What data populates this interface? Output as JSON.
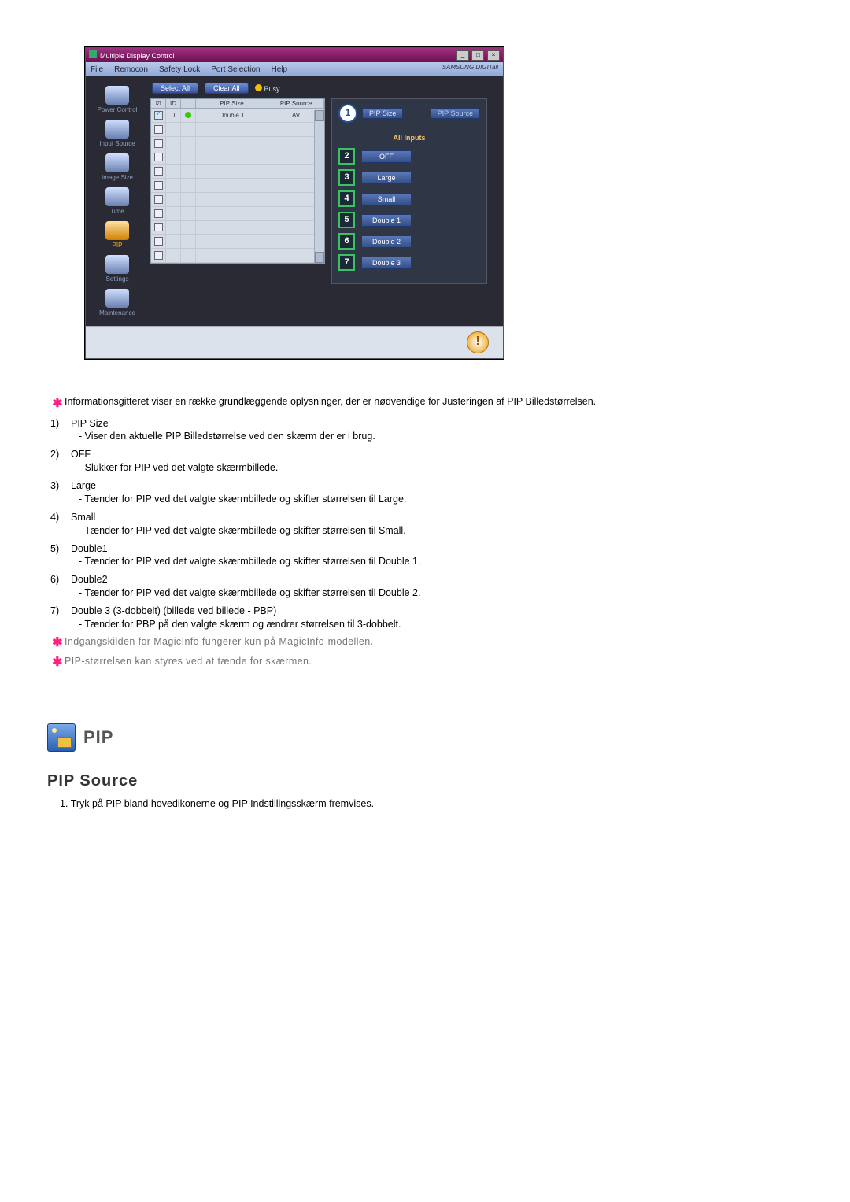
{
  "window": {
    "title": "Multiple Display Control",
    "menu": [
      "File",
      "Remocon",
      "Safety Lock",
      "Port Selection",
      "Help"
    ],
    "brand": "SAMSUNG DIGITall"
  },
  "sidebar": [
    {
      "label": "Power Control"
    },
    {
      "label": "Input Source"
    },
    {
      "label": "Image Size"
    },
    {
      "label": "Time"
    },
    {
      "label": "PIP",
      "active": true
    },
    {
      "label": "Settings"
    },
    {
      "label": "Maintenance"
    }
  ],
  "topbar": {
    "select_all": "Select All",
    "clear_all": "Clear All",
    "busy": "Busy"
  },
  "grid": {
    "headers": {
      "chk": "☑",
      "id": "ID",
      "st": "",
      "size": "PIP Size",
      "source": "PIP Source"
    },
    "first_row": {
      "id": "0",
      "size": "Double 1",
      "source": "AV"
    }
  },
  "panel": {
    "tab_size": "PIP Size",
    "tab_source": "PIP Source",
    "callout1": "1",
    "all_inputs": "All Inputs",
    "options": [
      {
        "n": "2",
        "label": "OFF"
      },
      {
        "n": "3",
        "label": "Large"
      },
      {
        "n": "4",
        "label": "Small"
      },
      {
        "n": "5",
        "label": "Double 1"
      },
      {
        "n": "6",
        "label": "Double 2"
      },
      {
        "n": "7",
        "label": "Double 3"
      }
    ]
  },
  "doc": {
    "lead": "Informationsgitteret viser en række grundlæggende oplysninger, der er nødvendige for Justeringen af PIP Billedstørrelsen.",
    "items": [
      {
        "n": "1)",
        "t": "PIP Size",
        "d": "Viser den aktuelle PIP Billedstørrelse ved den skærm der er i brug."
      },
      {
        "n": "2)",
        "t": "OFF",
        "d": "Slukker for PIP ved det valgte skærmbillede."
      },
      {
        "n": "3)",
        "t": "Large",
        "d": "Tænder for PIP ved det valgte skærmbillede og skifter størrelsen til Large."
      },
      {
        "n": "4)",
        "t": "Small",
        "d": "Tænder for PIP ved det valgte skærmbillede og skifter størrelsen til Small."
      },
      {
        "n": "5)",
        "t": "Double1",
        "d": "Tænder for PIP ved det valgte skærmbillede og skifter størrelsen til Double 1."
      },
      {
        "n": "6)",
        "t": "Double2",
        "d": "Tænder for PIP ved det valgte skærmbillede og skifter størrelsen til Double 2."
      },
      {
        "n": "7)",
        "t": "Double 3 (3-dobbelt) (billede ved billede - PBP)",
        "d": "Tænder for PBP på den valgte skærm og ændrer størrelsen til 3-dobbelt."
      }
    ],
    "star1": "Indgangskilden for MagicInfo fungerer kun på MagicInfo-modellen.",
    "star2": "PIP-størrelsen kan styres ved at tænde for skærmen."
  },
  "pip": {
    "title": "PIP",
    "subtitle": "PIP Source",
    "step1_n": "1.",
    "step1": "Tryk på PIP bland hovedikonerne og PIP Indstillingsskærm fremvises."
  }
}
